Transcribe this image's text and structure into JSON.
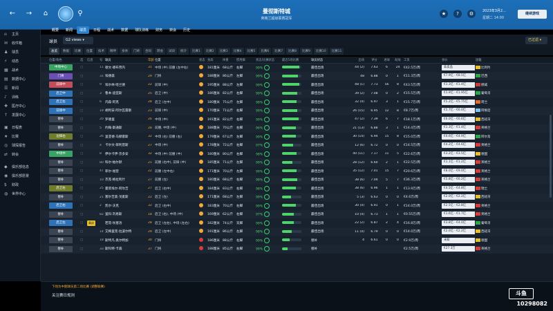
{
  "topbar": {
    "club_name": "曼彻斯特城",
    "club_sub": "英格兰超级联赛冠军",
    "date_line1": "2023年3月2...",
    "date_line2": "星期二 14:00",
    "continue_label": "继续游戏",
    "icons": [
      "back-arrow",
      "forward-arrow",
      "home",
      "search",
      "trophy",
      "help",
      "settings"
    ]
  },
  "nav": {
    "items": [
      "概要",
      "新闻",
      "球员",
      "日程",
      "战术",
      "数据",
      "球队训练",
      "财务",
      "转会",
      "历史"
    ],
    "active_index": 2
  },
  "views": {
    "squad_label": "球员",
    "views_label": "G2 views",
    "filter_label": "已过滤"
  },
  "chips": [
    "总览",
    "数据",
    "比赛",
    "位置",
    "技术",
    "精神",
    "身体",
    "门将",
    "合同",
    "转会",
    "试训",
    "统计",
    "比赛1",
    "比赛2",
    "比赛3",
    "比赛4",
    "比赛5",
    "比赛6",
    "比赛7",
    "比赛8",
    "比赛9",
    "比赛10",
    "比赛11"
  ],
  "sidebar": {
    "items": [
      {
        "label": "主页",
        "icon": "home"
      },
      {
        "label": "收件箱",
        "icon": "mail"
      },
      {
        "label": "球员",
        "icon": "shirt"
      },
      {
        "label": "动态",
        "icon": "bolt"
      },
      {
        "label": "战术",
        "icon": "board"
      },
      {
        "label": "数据中心",
        "icon": "chart"
      },
      {
        "label": "新闻",
        "icon": "news"
      },
      {
        "label": "训练",
        "icon": "whistle"
      },
      {
        "label": "医疗中心",
        "icon": "medical"
      },
      {
        "label": "发展中心",
        "icon": "growth"
      },
      {
        "label": "日程表",
        "icon": "calendar"
      },
      {
        "label": "比赛",
        "icon": "trophy"
      },
      {
        "label": "球探报告",
        "icon": "binoculars"
      },
      {
        "label": "转会",
        "icon": "transfer"
      },
      {
        "label": "俱乐部信息",
        "icon": "club"
      },
      {
        "label": "俱乐部愿景",
        "icon": "target"
      },
      {
        "label": "财政",
        "icon": "money"
      },
      {
        "label": "世界中心",
        "icon": "globe"
      }
    ]
  },
  "table": {
    "headers": [
      "位置/角色",
      "选",
      "信息",
      "号",
      "球员",
      "年龄",
      "位置",
      "状态",
      "身高",
      "体重",
      "惯用脚",
      "状态/比赛状态",
      "最近5场比赛",
      "球员状态",
      "出场",
      "评分",
      "进球",
      "助攻",
      "工资",
      "身价",
      "国籍"
    ],
    "rows": [
      {
        "role": "中场中心",
        "role_color": "#3aa364",
        "info": "",
        "info_color": "",
        "num": "11",
        "name": "德文·德布劳内",
        "age": "31",
        "pos": "中场 (中) 前腰 (左中右)",
        "cond_color": "#f2a93b",
        "height": "181厘米",
        "weight": "68公斤",
        "foot": "右脚",
        "fit": "99%",
        "form": 88,
        "status": "最佳出场",
        "apps": "44 (2)",
        "rating": "7.63",
        "gls": "6",
        "ast": "24",
        "wage": "€42.5万/周",
        "value": "非卖品",
        "nat": "比利时",
        "flag_color": "#e8c12a"
      },
      {
        "role": "门将",
        "role_color": "#6b4fb3",
        "info": "",
        "info_color": "",
        "num": "31",
        "name": "埃德森",
        "age": "29",
        "pos": "门将",
        "cond_color": "#f2a93b",
        "height": "188厘米",
        "weight": "86公斤",
        "foot": "左脚",
        "fit": "99%",
        "form": 82,
        "status": "最佳出场",
        "apps": "48",
        "rating": "6.88",
        "gls": "0",
        "ast": "1",
        "wage": "€11.3万/周",
        "value": "€7.9亿 - €8.5亿",
        "nat": "巴西",
        "flag_color": "#2aa84a"
      },
      {
        "role": "前锋中",
        "role_color": "#c34d5a",
        "info": "",
        "info_color": "",
        "num": "9",
        "name": "埃尔林·哈兰德",
        "age": "22",
        "pos": "前锋 (中)",
        "cond_color": "#f2a93b",
        "height": "195厘米",
        "weight": "88公斤",
        "foot": "左脚",
        "fit": "99%",
        "form": 90,
        "status": "最佳出场",
        "apps": "48 (1)",
        "rating": "7.73",
        "gls": "56",
        "ast": "8",
        "wage": "€43.5万/周",
        "value": "€1.3亿 - €1.4亿",
        "nat": "挪威",
        "flag_color": "#c93a3a"
      },
      {
        "role": "后卫中",
        "role_color": "#2e73b8",
        "info": "",
        "info_color": "",
        "num": "3",
        "name": "鲁本·迪亚斯",
        "age": "25",
        "pos": "后卫 (中)",
        "cond_color": "#f2a93b",
        "height": "186厘米",
        "weight": "82公斤",
        "foot": "右脚",
        "fit": "99%",
        "form": 78,
        "status": "最佳出场",
        "apps": "39 (2)",
        "rating": "7.08",
        "gls": "0",
        "ast": "2",
        "wage": "€15.5万/周",
        "value": "€1.9亿 - €1.95亿",
        "nat": "葡萄牙",
        "flag_color": "#2aa84a"
      },
      {
        "role": "后卫左",
        "role_color": "#2e73b8",
        "info": "",
        "info_color": "",
        "num": "6",
        "name": "内森·阿克",
        "age": "28",
        "pos": "后卫 (左中)",
        "cond_color": "#f2a93b",
        "height": "180厘米",
        "weight": "75公斤",
        "foot": "左脚",
        "fit": "98%",
        "form": 74,
        "status": "最佳出场",
        "apps": "32 (4)",
        "rating": "6.97",
        "gls": "3",
        "ast": "1",
        "wage": "€15.7万/周",
        "value": "€5.2亿 - €5.75亿",
        "nat": "荷兰",
        "flag_color": "#e06a2a"
      },
      {
        "role": "前锋中",
        "role_color": "#2e73b8",
        "info": "",
        "info_color": "",
        "num": "19",
        "name": "胡利安·阿尔瓦雷斯",
        "age": "23",
        "pos": "前锋 (中)",
        "cond_color": "#f2a93b",
        "height": "170厘米",
        "weight": "71公斤",
        "foot": "右脚",
        "fit": "99%",
        "form": 80,
        "status": "最佳出场",
        "apps": "26 (15)",
        "rating": "6.95",
        "gls": "12",
        "ast": "8",
        "wage": "€8.7万/周",
        "value": "€5.7亿 - €6.0亿",
        "nat": "阿根廷",
        "flag_color": "#7fc4ee"
      },
      {
        "role": "替补",
        "role_color": "#3a4452",
        "info": "",
        "info_color": "",
        "num": "20",
        "name": "罗德里",
        "age": "26",
        "pos": "中场 (中)",
        "cond_color": "#f2a93b",
        "height": "191厘米",
        "weight": "82公斤",
        "foot": "右脚",
        "fit": "99%",
        "form": 86,
        "status": "最佳出场",
        "apps": "47 (2)",
        "rating": "7.39",
        "gls": "6",
        "ast": "7",
        "wage": "€18.1万/周",
        "value": "€6.0亿 - €6.6亿",
        "nat": "西班牙",
        "flag_color": "#e8c12a"
      },
      {
        "role": "替补",
        "role_color": "#3a4452",
        "info": "",
        "info_color": "",
        "num": "5",
        "name": "约翰·斯通斯",
        "age": "28",
        "pos": "前腰, 中场 (中)",
        "cond_color": "#f2a93b",
        "height": "188厘米",
        "weight": "70公斤",
        "foot": "右脚",
        "fit": "96%",
        "form": 70,
        "status": "最佳出场",
        "apps": "21 (13)",
        "rating": "6.88",
        "gls": "3",
        "ast": "1",
        "wage": "€14.4万/周",
        "value": "€1.3亿 - €1.4亿",
        "nat": "英格兰",
        "flag_color": "#d93b3b"
      },
      {
        "role": "边锋右",
        "role_color": "#6f7d2c",
        "info": "",
        "info_color": "",
        "num": "26",
        "name": "里亚德·马赫雷斯",
        "age": "32",
        "pos": "中场 (右) 前腰 (右)",
        "cond_color": "#f2a93b",
        "height": "179厘米",
        "weight": "67公斤",
        "foot": "左脚",
        "fit": "99%",
        "form": 72,
        "status": "最佳出场",
        "apps": "30 (14)",
        "rating": "6.94",
        "gls": "15",
        "ast": "8",
        "wage": "€15.0万/周",
        "value": "€4.6亿 - €4.9亿",
        "nat": "阿尔及利亚",
        "flag_color": "#2aa84a"
      },
      {
        "role": "替补",
        "role_color": "#3a4452",
        "info": "",
        "info_color": "",
        "num": "4",
        "name": "卡尔文·菲利普斯",
        "age": "27",
        "pos": "中场 (中)",
        "cond_color": "#f2a93b",
        "height": "178厘米",
        "weight": "72公斤",
        "foot": "右脚",
        "fit": "97%",
        "form": 58,
        "status": "最佳出场",
        "apps": "12 (6)",
        "rating": "6.72",
        "gls": "0",
        "ast": "0",
        "wage": "€14.5万/周",
        "value": "€4.2亿 - €4.6亿",
        "nat": "英格兰",
        "flag_color": "#d93b3b"
      },
      {
        "role": "中场中",
        "role_color": "#3aa364",
        "info": "",
        "info_color": "",
        "num": "8",
        "name": "伊尔卡伊·京多安",
        "age": "32",
        "pos": "中场 (中) 前腰 (中)",
        "cond_color": "#f2a93b",
        "height": "180厘米",
        "weight": "80公斤",
        "foot": "右脚",
        "fit": "98%",
        "form": 76,
        "status": "最佳出场",
        "apps": "40 (11)",
        "rating": "7.17",
        "gls": "11",
        "ast": "5",
        "wage": "€22.6万/周",
        "value": "€3.2亿 - €3.5亿",
        "nat": "德国",
        "flag_color": "#e8c12a"
      },
      {
        "role": "替补",
        "role_color": "#3a4452",
        "info": "",
        "info_color": "",
        "num": "80",
        "name": "科尔·帕尔默",
        "age": "21",
        "pos": "前腰 (右中), 前锋 (中)",
        "cond_color": "#f2a93b",
        "height": "185厘米",
        "weight": "71公斤",
        "foot": "左脚",
        "fit": "99%",
        "form": 55,
        "status": "最佳出场",
        "apps": "28 (12)",
        "rating": "6.60",
        "gls": "2",
        "ast": "1",
        "wage": "€22.5万/周",
        "value": "€1.1亿 - €1.2亿",
        "nat": "英格兰",
        "flag_color": "#d93b3b"
      },
      {
        "role": "替补",
        "role_color": "#3a4452",
        "info": "",
        "info_color": "",
        "num": "47",
        "name": "菲尔·福登",
        "age": "22",
        "pos": "前腰 (左中右)",
        "cond_color": "#f2a93b",
        "height": "171厘米",
        "weight": "70公斤",
        "foot": "左脚",
        "fit": "99%",
        "form": 74,
        "status": "最佳出场",
        "apps": "35 (12)",
        "rating": "7.01",
        "gls": "15",
        "ast": "7",
        "wage": "€20.6万/周",
        "value": "€8.0亿 - €9.0亿",
        "nat": "英格兰",
        "flag_color": "#d93b3b"
      },
      {
        "role": "替补",
        "role_color": "#3a4452",
        "info": "",
        "info_color": "",
        "num": "10",
        "name": "杰克·格拉利什",
        "age": "27",
        "pos": "前腰 (左)",
        "cond_color": "#f2a93b",
        "height": "180厘米",
        "weight": "68公斤",
        "foot": "右脚",
        "fit": "98%",
        "form": 78,
        "status": "最佳出场",
        "apps": "38 (6)",
        "rating": "7.04",
        "gls": "5",
        "ast": "7",
        "wage": "€36.3万/周",
        "value": "€5.8亿 - €6.2亿",
        "nat": "英格兰",
        "flag_color": "#d93b3b"
      },
      {
        "role": "后卫左",
        "role_color": "#6f7d2c",
        "info": "",
        "info_color": "",
        "num": "25",
        "name": "曼努埃尔·阿坎吉",
        "age": "27",
        "pos": "后卫 (右中)",
        "cond_color": "#f2a93b",
        "height": "184厘米",
        "weight": "83公斤",
        "foot": "右脚",
        "fit": "98%",
        "form": 70,
        "status": "最佳出场",
        "apps": "38 (6)",
        "rating": "6.96",
        "gls": "1",
        "ast": "1",
        "wage": "€13.9万/周",
        "value": "€4.5亿 - €4.8亿",
        "nat": "瑞士",
        "flag_color": "#d93b3b"
      },
      {
        "role": "替补",
        "role_color": "#3a4452",
        "info": "",
        "info_color": "",
        "num": "21",
        "name": "塞尔吉奥·戈麦斯",
        "age": "22",
        "pos": "后卫 (左)",
        "cond_color": "#f2a93b",
        "height": "171厘米",
        "weight": "68公斤",
        "foot": "左脚",
        "fit": "99%",
        "form": 48,
        "status": "最佳出场",
        "apps": "5 (3)",
        "rating": "6.63",
        "gls": "0",
        "ast": "0",
        "wage": "€4.6万/周",
        "value": "€2.0亿 - €2.2亿",
        "nat": "西班牙",
        "flag_color": "#e8c12a"
      },
      {
        "role": "后卫右",
        "role_color": "#2e73b8",
        "info": "",
        "info_color": "",
        "num": "2",
        "name": "凯尔·沃克",
        "age": "32",
        "pos": "后卫 (右中)",
        "cond_color": "#f2a93b",
        "height": "183厘米",
        "weight": "70公斤",
        "foot": "右脚",
        "fit": "99%",
        "form": 72,
        "status": "最佳出场",
        "apps": "30 (4)",
        "rating": "6.91",
        "gls": "0",
        "ast": "1",
        "wage": "€14.0万/周",
        "value": "€2.5亿 - €2.8亿",
        "nat": "英格兰",
        "flag_color": "#d93b3b"
      },
      {
        "role": "替补",
        "role_color": "#3a4452",
        "info": "",
        "info_color": "",
        "num": "82",
        "name": "里科·刘易斯",
        "age": "18",
        "pos": "后卫 (右), 中场 (中)",
        "cond_color": "#f2a93b",
        "height": "169厘米",
        "weight": "62公斤",
        "foot": "右脚",
        "fit": "97%",
        "form": 62,
        "status": "最佳出场",
        "apps": "10 (4)",
        "rating": "6.73",
        "gls": "1",
        "ast": "1",
        "wage": "€0.55万/周",
        "value": "€1.6亿 - €1.7亿",
        "nat": "英格兰",
        "flag_color": "#d93b3b"
      },
      {
        "role": "后卫左",
        "role_color": "#2e73b8",
        "info": "青训",
        "info_color": "#e8c12a",
        "num": "",
        "name": "若昂·坎塞洛",
        "age": "28",
        "pos": "后卫 (左右), 中场 (左右)",
        "cond_color": "#f2a93b",
        "height": "182厘米",
        "weight": "74公斤",
        "foot": "双脚",
        "fit": "99%",
        "form": 60,
        "status": "最佳出场",
        "apps": "22 (2)",
        "rating": "6.87",
        "gls": "2",
        "ast": "4",
        "wage": "€16.8万/周",
        "value": "€3.8亿 - €4.0亿",
        "nat": "葡萄牙",
        "flag_color": "#2aa84a"
      },
      {
        "role": "替补",
        "role_color": "#3a4452",
        "info": "",
        "info_color": "",
        "num": "14",
        "name": "艾梅里克·拉波尔特",
        "age": "29",
        "pos": "后卫 (左中)",
        "cond_color": "#f2a93b",
        "height": "191厘米",
        "weight": "86公斤",
        "foot": "左脚",
        "fit": "98%",
        "form": 50,
        "status": "最佳出场",
        "apps": "11 (4)",
        "rating": "6.79",
        "gls": "0",
        "ast": "0",
        "wage": "€14.0万/周",
        "value": "€2.0亿 - €2.2亿",
        "nat": "西班牙",
        "flag_color": "#e8c12a"
      },
      {
        "role": "替补",
        "role_color": "#3a4452",
        "info": "",
        "info_color": "",
        "num": "18",
        "name": "斯特凡·奥尔特加",
        "age": "30",
        "pos": "门将",
        "cond_color": "#d93b3b",
        "height": "186厘米",
        "weight": "88公斤",
        "foot": "右脚",
        "fit": "99%",
        "form": 40,
        "status": "替补",
        "apps": "4",
        "rating": "6.61",
        "gls": "0",
        "ast": "0",
        "wage": "€2.9万/周",
        "value": "未知",
        "nat": "德国",
        "flag_color": "#e8c12a"
      },
      {
        "role": "替补",
        "role_color": "#3a4452",
        "info": "",
        "info_color": "",
        "num": "33",
        "name": "斯科特·卡森",
        "age": "37",
        "pos": "门将",
        "cond_color": "#d93b3b",
        "height": "188厘米",
        "weight": "85公斤",
        "foot": "右脚",
        "fit": "99%",
        "form": 30,
        "status": "替补",
        "apps": "",
        "rating": "",
        "gls": "",
        "ast": "",
        "wage": "€2.5万/周",
        "value": "€27.3万",
        "nat": "英格兰",
        "flag_color": "#d93b3b"
      }
    ]
  },
  "footer": {
    "note": "下场为中期球员第二场比赛 (调整联赛)",
    "title": "关注赛日规则",
    "logo_text": "斗鱼",
    "stream_id": "10298082"
  }
}
